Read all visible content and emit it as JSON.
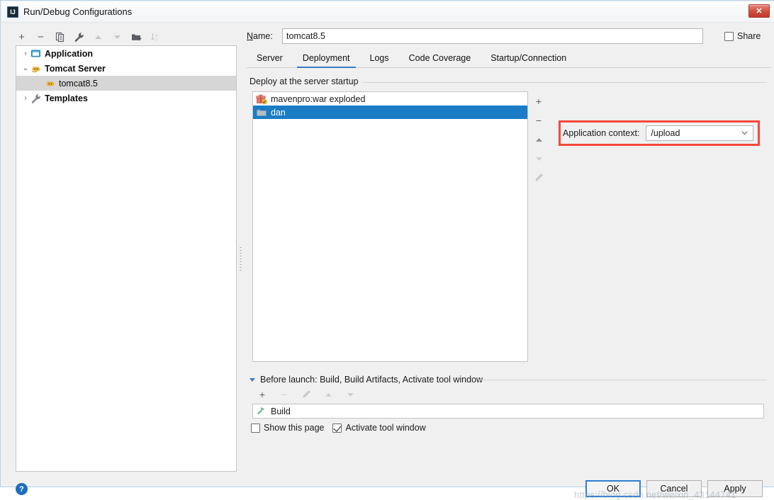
{
  "window": {
    "title": "Run/Debug Configurations",
    "app_icon": "intellij-idea-icon",
    "close_label": "✕"
  },
  "left_toolbar": {
    "items": [
      {
        "icon": "plus-icon",
        "label": "+",
        "enabled": true
      },
      {
        "icon": "minus-icon",
        "label": "−",
        "enabled": true
      },
      {
        "icon": "copy-icon",
        "label": "",
        "enabled": true
      },
      {
        "icon": "wrench-icon",
        "label": "",
        "enabled": true
      },
      {
        "icon": "move-up-icon",
        "label": "",
        "enabled": false
      },
      {
        "icon": "move-down-icon",
        "label": "",
        "enabled": false
      },
      {
        "icon": "new-folder-icon",
        "label": "",
        "enabled": true
      },
      {
        "icon": "sort-alphabetically-icon",
        "label": "",
        "enabled": false
      }
    ]
  },
  "tree": {
    "items": [
      {
        "label": "Application",
        "icon": "application-icon",
        "twisty": "›",
        "expanded": false,
        "selected": false,
        "child": false
      },
      {
        "label": "Tomcat Server",
        "icon": "tomcat-icon",
        "twisty": "⌄",
        "expanded": true,
        "selected": false,
        "child": false
      },
      {
        "label": "tomcat8.5",
        "icon": "tomcat-icon",
        "twisty": "",
        "expanded": false,
        "selected": true,
        "child": true
      },
      {
        "label": "Templates",
        "icon": "wrench-icon",
        "twisty": "›",
        "expanded": false,
        "selected": false,
        "child": false
      }
    ]
  },
  "name_row": {
    "label": "Name:",
    "label_mnemonic": "N",
    "value": "tomcat8.5",
    "placeholder": "",
    "share_label": "Share",
    "share_checked": false
  },
  "tabs": {
    "items": [
      {
        "label": "Server",
        "active": false
      },
      {
        "label": "Deployment",
        "active": true
      },
      {
        "label": "Logs",
        "active": false
      },
      {
        "label": "Code Coverage",
        "active": false
      },
      {
        "label": "Startup/Connection",
        "active": false
      }
    ],
    "accent_color": "#3a7cc4"
  },
  "deployment": {
    "group_title": "Deploy at the server startup",
    "list": [
      {
        "label": "mavenpro:war exploded",
        "icon": "artifact-icon",
        "selected": false
      },
      {
        "label": "dan",
        "icon": "folder-icon",
        "selected": true
      }
    ],
    "selection_color": "#1a7cc4",
    "toolbar": [
      {
        "icon": "add-icon",
        "label": "+",
        "enabled": true
      },
      {
        "icon": "remove-icon",
        "label": "−",
        "enabled": true
      },
      {
        "icon": "move-up-icon",
        "label": "",
        "enabled": true
      },
      {
        "icon": "move-down-icon",
        "label": "",
        "enabled": false
      },
      {
        "icon": "edit-pencil-icon",
        "label": "",
        "enabled": false
      }
    ],
    "application_context": {
      "label": "Application context:",
      "value": "/upload",
      "highlight_color": "#f5483b",
      "highlighted": true
    }
  },
  "before_launch": {
    "title": "Before launch: Build, Build Artifacts, Activate tool window",
    "title_mnemonic": "B",
    "expanded": true,
    "toolbar": [
      {
        "icon": "add-icon",
        "label": "+",
        "enabled": true
      },
      {
        "icon": "remove-icon",
        "label": "−",
        "enabled": false
      },
      {
        "icon": "edit-pencil-icon",
        "label": "",
        "enabled": false
      },
      {
        "icon": "move-up-icon",
        "label": "",
        "enabled": false
      },
      {
        "icon": "move-down-icon",
        "label": "",
        "enabled": false
      }
    ],
    "items": [
      {
        "label": "Build",
        "icon": "build-hammer-icon"
      }
    ]
  },
  "bottom_checks": [
    {
      "label": "Show this page",
      "checked": false,
      "name": "show-this-page"
    },
    {
      "label": "Activate tool window",
      "checked": true,
      "name": "activate-tool-window"
    }
  ],
  "footer": {
    "help_label": "?",
    "buttons": [
      {
        "label": "OK",
        "default": true,
        "mnemonic": ""
      },
      {
        "label": "Cancel",
        "default": false,
        "mnemonic": ""
      },
      {
        "label": "Apply",
        "default": false,
        "mnemonic": "A"
      }
    ]
  },
  "watermark": "https://blog.csdn.net/weixin_43144741"
}
